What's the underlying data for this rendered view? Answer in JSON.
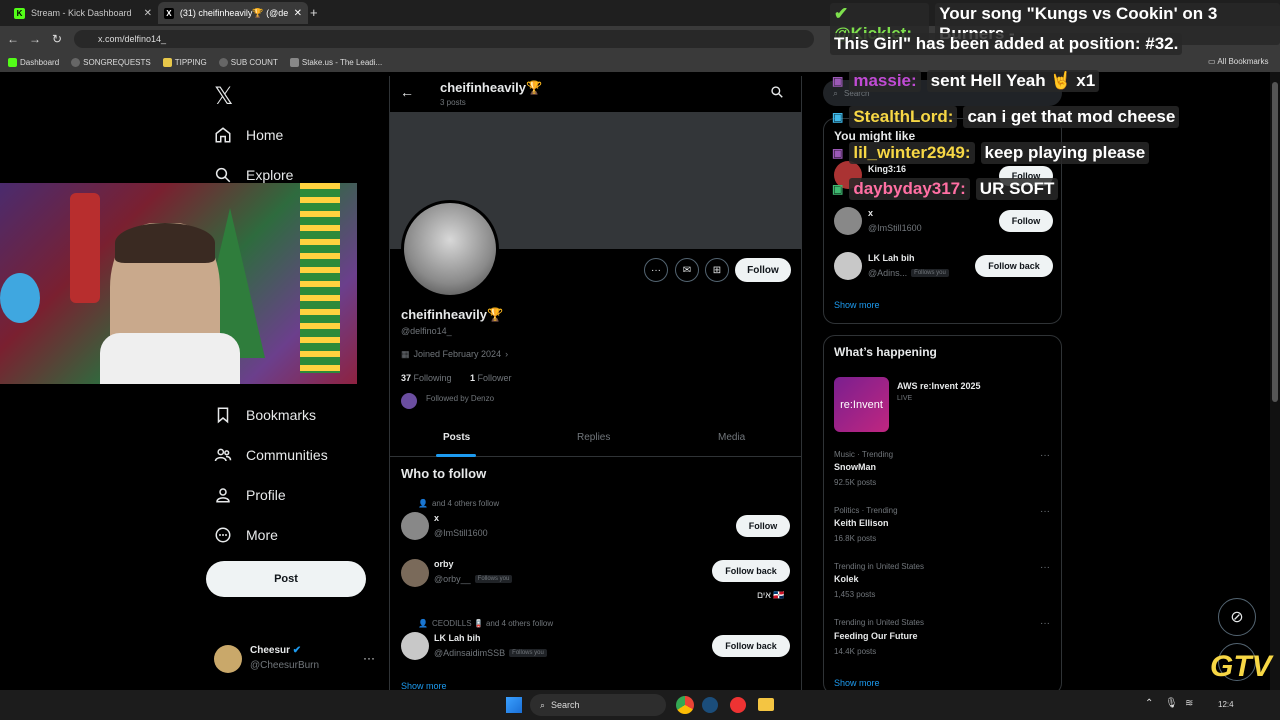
{
  "browser": {
    "tabs": [
      {
        "title": "Stream - Kick Dashboard"
      },
      {
        "title": "(31) cheifinheavily🏆 (@delfin"
      }
    ],
    "url": "x.com/delfino14_",
    "bookmarks": [
      "Dashboard",
      "SONGREQUESTS",
      "TIPPING",
      "SUB COUNT",
      "Stake.us - The Leadi..."
    ],
    "all_bookmarks": "All Bookmarks"
  },
  "nav": {
    "logo": "𝕏",
    "items": [
      "Home",
      "Explore",
      "Bookmarks",
      "Communities",
      "Profile",
      "More"
    ],
    "post": "Post",
    "account": {
      "name": "Cheesur",
      "handle": "@CheesurBurn"
    }
  },
  "profile": {
    "header_name": "cheifinheavily🏆",
    "header_posts": "3 posts",
    "name": "cheifinheavily🏆",
    "handle": "@delfino14_",
    "joined": "Joined February 2024",
    "following_count": "37",
    "following_label": "Following",
    "followers_count": "1",
    "followers_label": "Follower",
    "followed_by": "Followed by Denzo",
    "follow_btn": "Follow",
    "tabs": [
      "Posts",
      "Replies",
      "Media"
    ]
  },
  "who_to_follow": {
    "title": "Who to follow",
    "items": [
      {
        "context": "and 4 others follow",
        "name": "x",
        "handle": "@ImStill1600",
        "tag": "",
        "btn": "Follow"
      },
      {
        "context": "",
        "name": "orby",
        "handle": "@orby__",
        "tag": "Follows you",
        "btn": "Follow back",
        "bio": "אים 🇩🇴"
      },
      {
        "context": "CEODILLS 🪫 and 4 others follow",
        "name": "LK Lah bih",
        "handle": "@AdinsaidimSSB",
        "tag": "Follows you",
        "btn": "Follow back"
      }
    ],
    "show_more": "Show more"
  },
  "right": {
    "search": "Search",
    "you_might_like": "You might like",
    "suggestions": [
      {
        "name": "King3:16",
        "handle": "",
        "tag": "",
        "btn": "Follow"
      },
      {
        "name": "x",
        "handle": "@ImStill1600",
        "tag": "",
        "btn": "Follow"
      },
      {
        "name": "LK Lah bih",
        "handle": "@Adins...",
        "tag": "Follows you",
        "btn": "Follow back"
      }
    ],
    "show_more": "Show more",
    "happening_title": "What’s happening",
    "event": {
      "title": "AWS re:Invent 2025",
      "status": "LIVE",
      "thumb": "re:Invent"
    },
    "trends": [
      {
        "context": "Music · Trending",
        "name": "SnowMan",
        "posts": "92.5K posts"
      },
      {
        "context": "Politics · Trending",
        "name": "Keith Ellison",
        "posts": "16.8K posts"
      },
      {
        "context": "Trending in United States",
        "name": "Kolek",
        "posts": "1,453 posts"
      },
      {
        "context": "Trending in United States",
        "name": "Feeding Our Future",
        "posts": "14.4K posts"
      }
    ],
    "show_more2": "Show more"
  },
  "chat": [
    {
      "name": "@Kicklet:",
      "msg": "Your song \"Kungs vs Cookin' on 3 Burners -",
      "color": "#7ee04d"
    },
    {
      "name": "",
      "msg": "This Girl\" has been added at position: #32.",
      "color": "#ffffff"
    },
    {
      "name": "massie:",
      "msg": "sent Hell Yeah 🤘 x1",
      "color": "#c04bd4"
    },
    {
      "name": "StealthLord:",
      "msg": "can i get that mod cheese",
      "color": "#f7d745"
    },
    {
      "name": "lil_winter2949:",
      "msg": "keep playing please",
      "color": "#f7d745"
    },
    {
      "name": "daybyday317:",
      "msg": "UR SOFT",
      "color": "#ff6fa3"
    }
  ],
  "taskbar": {
    "search": "Search",
    "time": "12:4"
  },
  "colors": {
    "accent": "#1d9bf0",
    "background": "#000000",
    "border": "#2f3336",
    "muted": "#71767b"
  }
}
